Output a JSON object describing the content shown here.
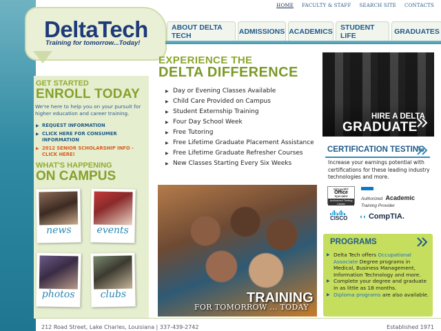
{
  "top_nav": [
    "HOME",
    "FACULTY & STAFF",
    "SEARCH SITE",
    "CONTACTS"
  ],
  "logo": {
    "name": "DeltaTech",
    "tagline": "Training for tomorrow...Today!"
  },
  "main_nav": [
    "ABOUT DELTA TECH",
    "ADMISSIONS",
    "ACADEMICS",
    "STUDENT LIFE",
    "GRADUATES"
  ],
  "sidebar": {
    "get_started": "GET STARTED",
    "enroll": "ENROLL TODAY",
    "description": "We're here to help you on your pursuit for higher education and career training.",
    "links": [
      "REQUEST INFORMATION",
      "CLICK HERE FOR CONSUMER INFORMATION",
      "2012 SENIOR SCHOLARSHIP INFO - CLICK HERE!"
    ],
    "happening": "WHAT'S HAPPENING",
    "campus": "ON CAMPUS",
    "tiles": [
      "news",
      "events",
      "photos",
      "clubs"
    ]
  },
  "center": {
    "headline_1": "EXPERIENCE THE",
    "headline_2": "DELTA DIFFERENCE",
    "benefits": [
      "Day or Evening Classes Available",
      "Child Care Provided on Campus",
      "Student Externship Training",
      "Four Day School Week",
      "Free Tutoring",
      "Free Lifetime Graduate Placement Assistance",
      "Free Lifetime Graduate Refresher Courses",
      "New Classes Starting Every Six Weeks"
    ],
    "photo_title": "TRAINING",
    "photo_sub": "FOR TOMORROW ... TODAY"
  },
  "graduate": {
    "line1": "HIRE A DELTA",
    "line2": "GRADUATE"
  },
  "certification": {
    "title": "CERTIFICATION TESTING",
    "desc": "Increase your earnings potential with certifications for these leading industry technologies and more.",
    "ms": {
      "line1": "Microsoft®",
      "line2": "Office",
      "line3": "Specialist",
      "strip": "Authorized Testing Center"
    },
    "aatp": {
      "line1": "Authorized",
      "line2": "Academic",
      "line3": "Training Provider"
    },
    "cisco": "CISCO",
    "comptia": "CompTIA."
  },
  "programs": {
    "title": "PROGRAMS",
    "item1_pre": "Delta Tech offers",
    "item1_link": "Occupational Associate",
    "item1_post": "Degree programs in Medical, Business Management, Information Technology and more.",
    "item2": "Complete your degree and graduate in as little as 18 months.",
    "item3_link": "Diploma programs",
    "item3_post": "are also available."
  },
  "footer": {
    "address": "212 Road Street, Lake Charles, Louisiana  |  337-439-2742",
    "established": "Established 1971"
  },
  "colors": {
    "teal": "#2f8aa3",
    "green": "#85a12a",
    "navy": "#1e3a78",
    "program_bg": "#c6de5e",
    "link_orange": "#d95a1b"
  }
}
